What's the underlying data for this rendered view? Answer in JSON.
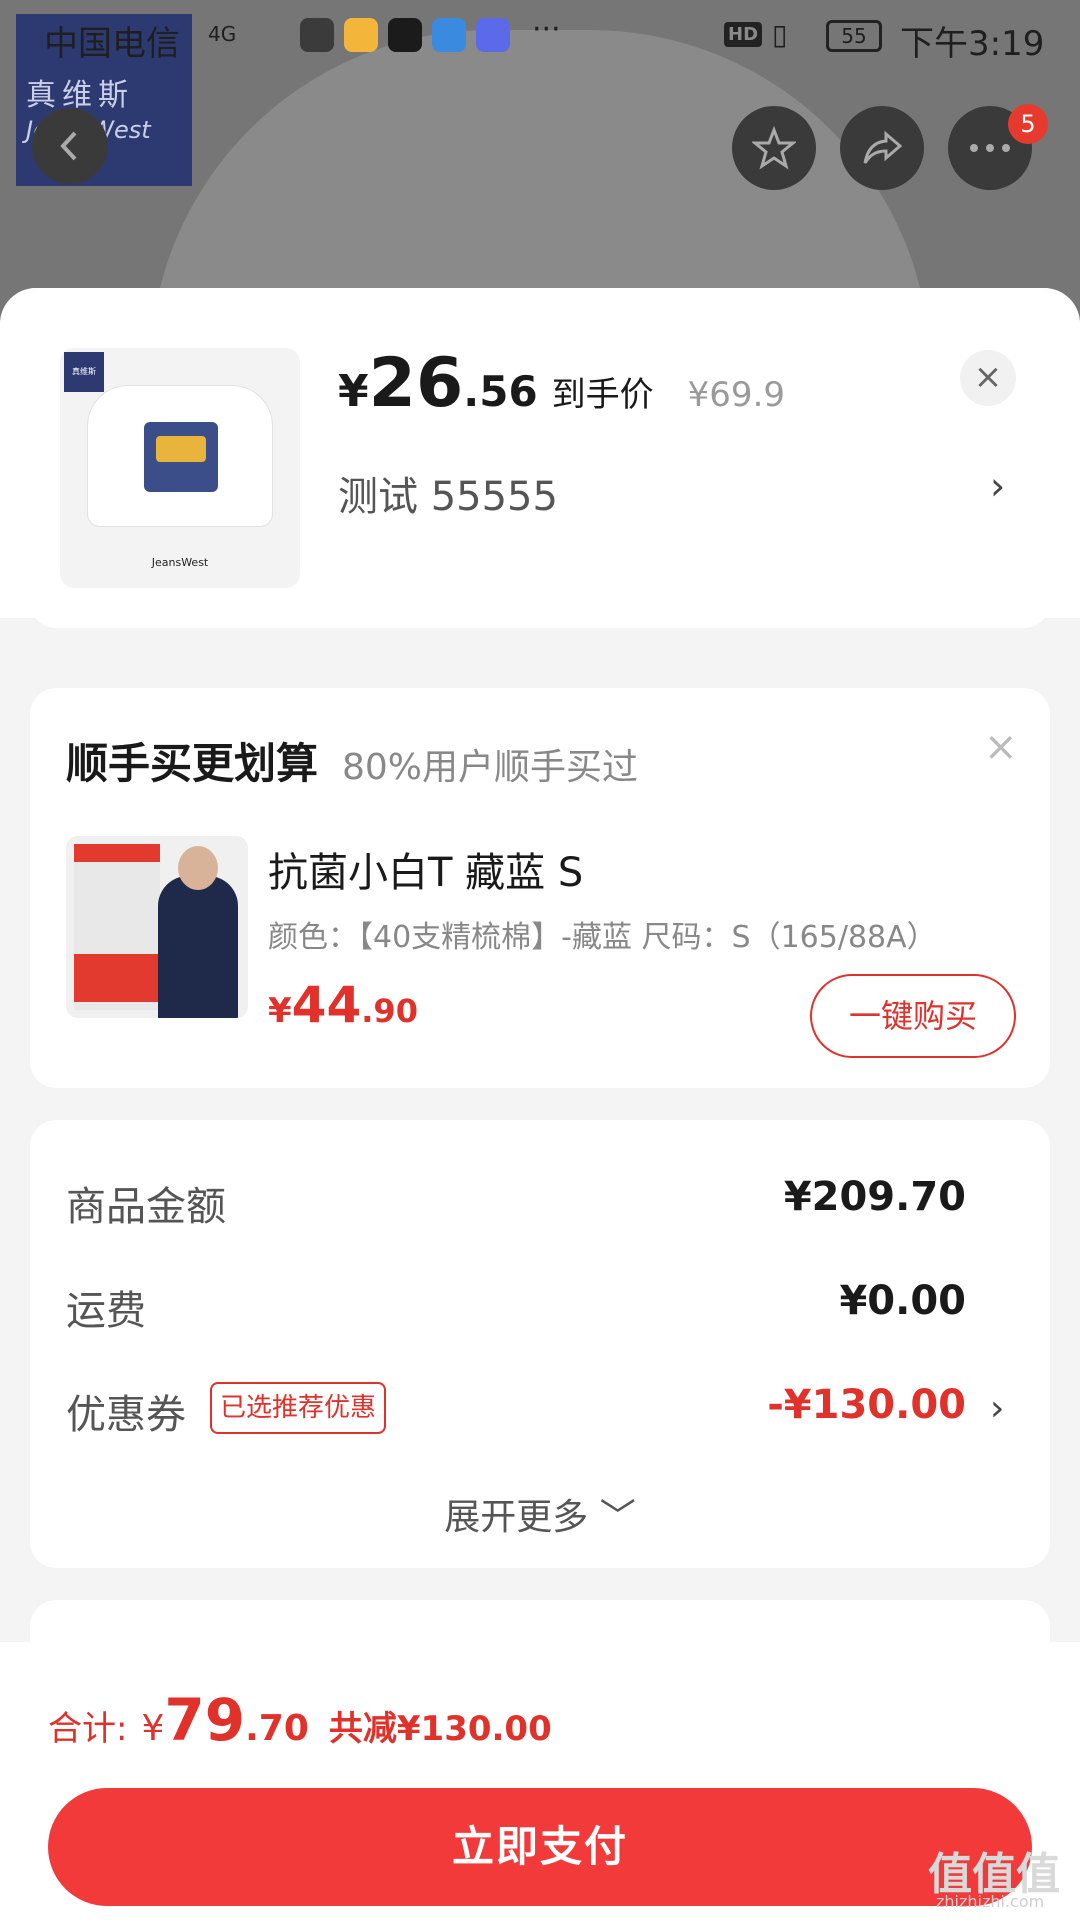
{
  "status_bar": {
    "carrier": "中国电信",
    "network": "4G",
    "battery": "55",
    "time": "下午3:19"
  },
  "background": {
    "brand_cn": "真维斯",
    "brand_en": "JeansWest"
  },
  "nav": {
    "more_badge": "5"
  },
  "product": {
    "price_symbol": "¥",
    "price_int": "26",
    "price_dec": ".56",
    "price_tag": "到手价",
    "original_price": "¥69.9",
    "variant": "测试  55555"
  },
  "upsell": {
    "title": "顺手买更划算",
    "subtitle": "80%用户顺手买过",
    "item": {
      "name": "抗菌小白T 藏蓝 S",
      "spec": "颜色：【40支精梳棉】-藏蓝   尺码：S（165/88A）",
      "price_symbol": "¥",
      "price_int": "44",
      "price_dec": ".90",
      "buy_label": "一键购买"
    }
  },
  "summary": {
    "goods_label": "商品金额",
    "goods_value": "¥209.70",
    "shipping_label": "运费",
    "shipping_value": "¥0.00",
    "coupon_label": "优惠券",
    "coupon_tag": "已选推荐优惠",
    "coupon_value": "-¥130.00",
    "expand_label": "展开更多 ﹀"
  },
  "footer": {
    "total_label": "合计:",
    "total_symbol": "¥",
    "total_int": "79",
    "total_dec": ".70",
    "saved": "共减¥130.00",
    "pay_label": "立即支付"
  },
  "watermark": {
    "main": "值值值",
    "site": "zhizhizhi.com"
  },
  "colors": {
    "accent_red": "#e0322a",
    "pay_button": "#f23a3a"
  }
}
